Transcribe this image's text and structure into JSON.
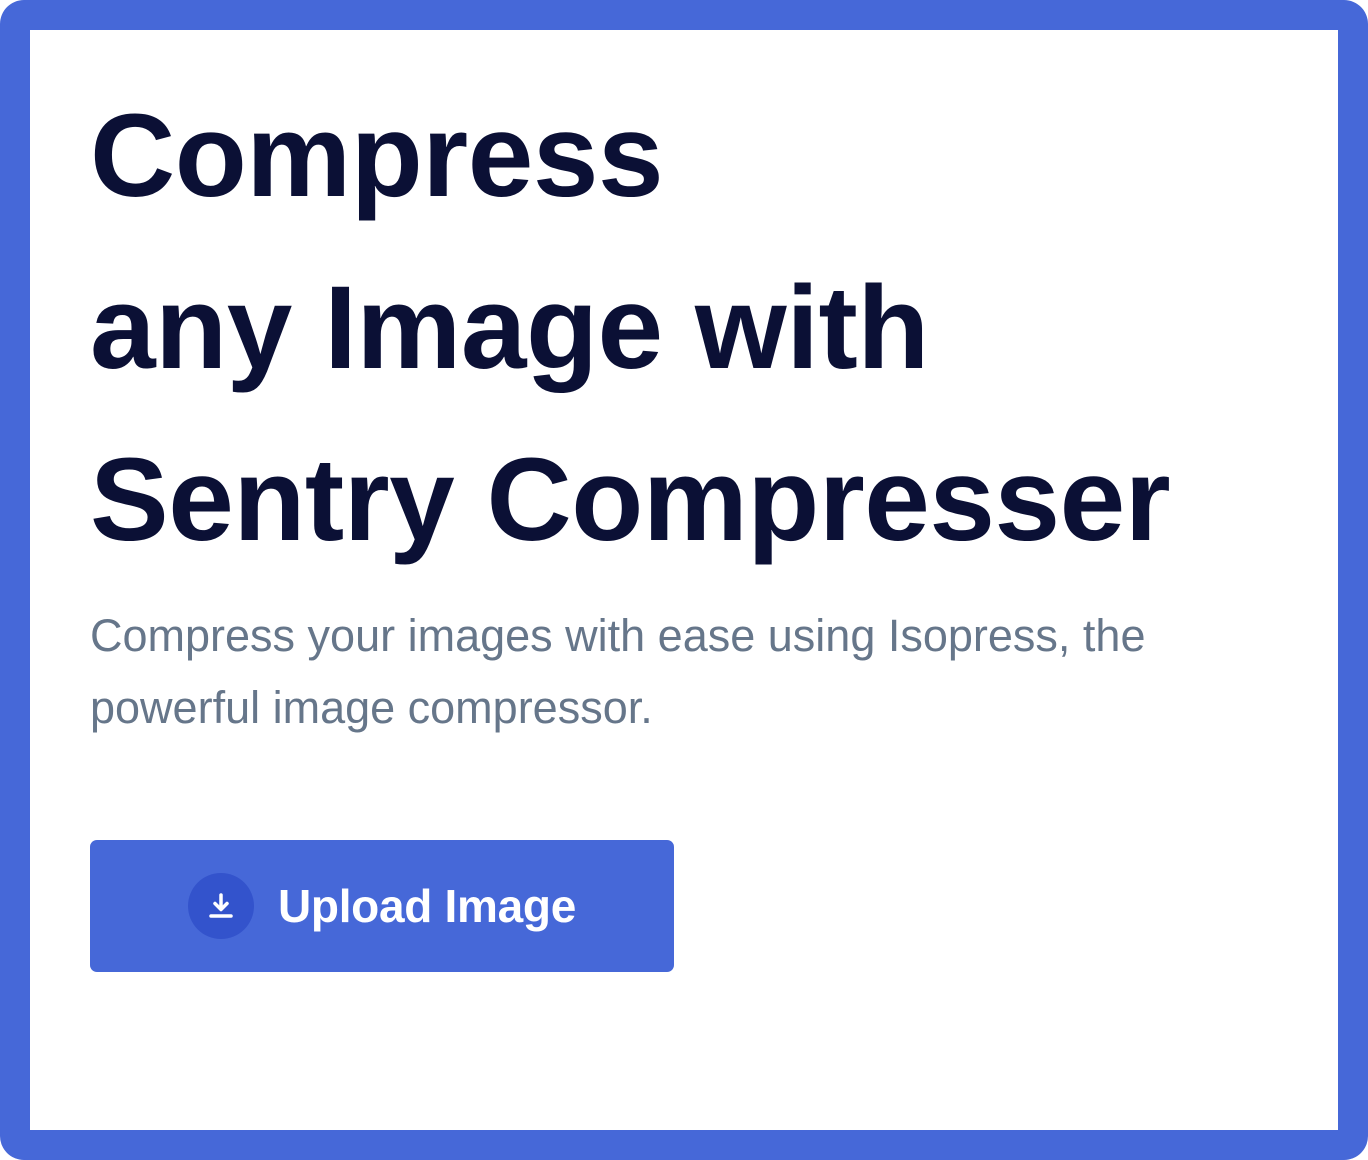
{
  "hero": {
    "headline_lines": [
      "Compress",
      "any Image with",
      "Sentry Compresser"
    ],
    "subtitle": "Compress your images with ease using Isopress, the powerful image compressor."
  },
  "upload_button": {
    "label": "Upload Image",
    "icon": "download-icon"
  },
  "colors": {
    "accent": "#4668d8",
    "icon_circle": "#3353cc",
    "headline": "#0b1035",
    "subtitle": "#66768a",
    "background": "#ffffff"
  }
}
